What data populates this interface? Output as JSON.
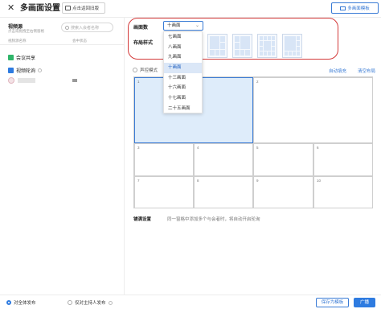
{
  "header": {
    "close_icon": "close-icon",
    "title": "多画面设置",
    "return_label": "点击返回旧版",
    "template_label": "多画面模板"
  },
  "sources": {
    "title": "视频源",
    "subtitle": "点击或拖拽至右侧窗格",
    "search_placeholder": "搜索入会者名称",
    "col_name": "视频源名称",
    "col_status": "会中状态",
    "items": [
      {
        "label": "会议共享",
        "icon": "share-icon",
        "color": "#2fb56a"
      },
      {
        "label": "视频轮询",
        "icon": "poll-icon",
        "color": "#2e7be0"
      }
    ]
  },
  "layout": {
    "count_label": "画面数",
    "style_label": "布局样式",
    "selected_count": "十画面",
    "options": [
      "七画面",
      "八画面",
      "九画面",
      "十画面",
      "十三画面",
      "十六画面",
      "十七画面",
      "二十五画面"
    ],
    "selected_index": 3
  },
  "grid": {
    "voice_mode_label": "声控模式",
    "auto_fill_label": "自动填充",
    "clear_label": "清空布局",
    "cells": [
      "1",
      "2",
      "3",
      "4",
      "5",
      "6",
      "7",
      "8",
      "9",
      "10"
    ]
  },
  "fit": {
    "label": "铺满设置",
    "description": "同一窗格中添加多个与会者时，将自动开启轮询"
  },
  "footer": {
    "mode_all": "对全体发布",
    "mode_host": "仅对主持人发布",
    "save_template": "保存为模板",
    "broadcast": "广播"
  },
  "colors": {
    "accent": "#2e7be0",
    "highlight_border": "#d33a3a",
    "active_cell": "#deecfa"
  }
}
